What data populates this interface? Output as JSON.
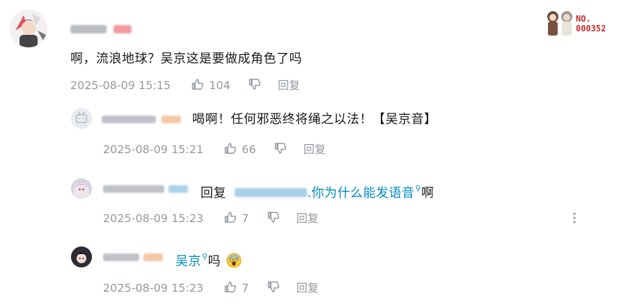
{
  "colors": {
    "text": "#18191c",
    "meta": "#9499a0",
    "link": "#008ac5",
    "badge": "#c22d2d"
  },
  "comments": [
    {
      "avatar": "illustrated-character-avatar",
      "content": "啊，流浪地球？吴京这是要做成角色了吗",
      "time": "2025-08-09 15:15",
      "likes": "104",
      "reply_label": "回复"
    }
  ],
  "fan_badge": {
    "label": "NO.",
    "number": "000352"
  },
  "replies": [
    {
      "avatar": "default-tv-avatar",
      "content": "喝啊！任何邪恶终将绳之以法！【吴京音】",
      "time": "2025-08-09 15:21",
      "likes": "66",
      "reply_label": "回复"
    },
    {
      "avatar": "anime-girl-avatar",
      "prefix": "回复",
      "content": ".你为什么能发语音",
      "tail": "啊",
      "time": "2025-08-09 15:23",
      "likes": "7",
      "reply_label": "回复"
    },
    {
      "avatar": "anime-girl-dark-avatar",
      "link": "吴京",
      "content": "吗",
      "emoji": "screaming-face-emoji",
      "time": "2025-08-09 15:23",
      "likes": "7",
      "reply_label": "回复"
    }
  ]
}
